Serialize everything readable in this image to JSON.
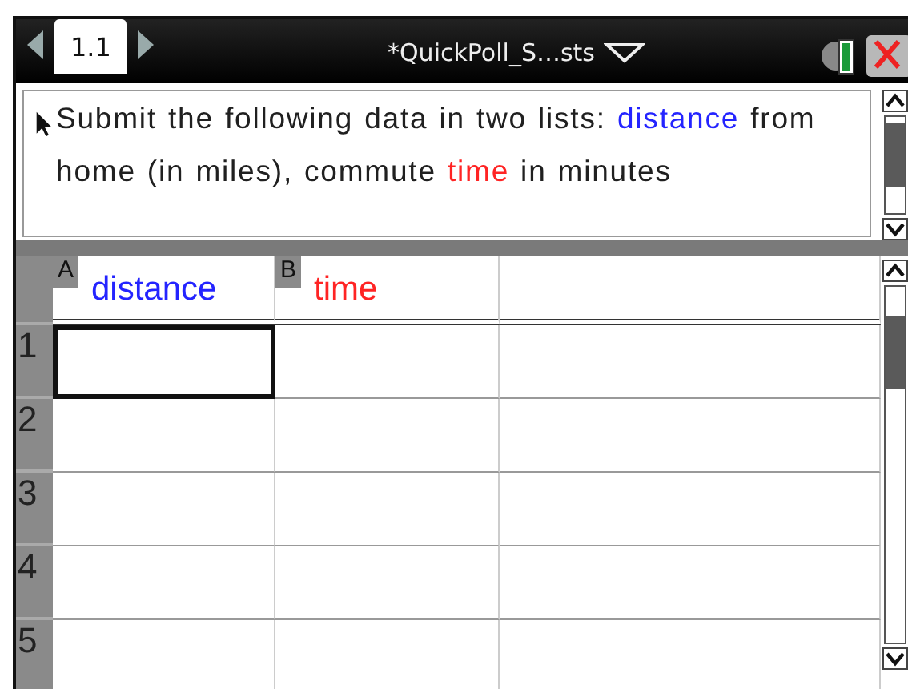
{
  "topbar": {
    "tab": {
      "label": "1.1",
      "selected": true
    },
    "title": "*QuickPoll_S…sts"
  },
  "question": {
    "segments": [
      {
        "text": "Submit the following data in two lists: ",
        "color": "#202020"
      },
      {
        "text": "distance",
        "color": "#2424ff"
      },
      {
        "text": " from home (in miles), commute ",
        "color": "#202020"
      },
      {
        "text": "time",
        "color": "#ff2424"
      },
      {
        "text": " in minutes",
        "color": "#202020"
      }
    ]
  },
  "sheet": {
    "columns": [
      {
        "letter": "A",
        "name": "distance",
        "color": "#2424ff"
      },
      {
        "letter": "B",
        "name": "time",
        "color": "#ff2424"
      }
    ],
    "rows": [
      {
        "label": "1",
        "cells": [
          {
            "selected": true
          },
          {
            "selected": false
          }
        ]
      },
      {
        "label": "2",
        "cells": [
          {
            "selected": false
          },
          {
            "selected": false
          }
        ]
      },
      {
        "label": "3",
        "cells": [
          {
            "selected": false
          },
          {
            "selected": false
          }
        ]
      },
      {
        "label": "4",
        "cells": [
          {
            "selected": false
          },
          {
            "selected": false
          }
        ]
      },
      {
        "label": "5",
        "cells": [
          {
            "selected": false
          },
          {
            "selected": false
          }
        ]
      }
    ]
  }
}
